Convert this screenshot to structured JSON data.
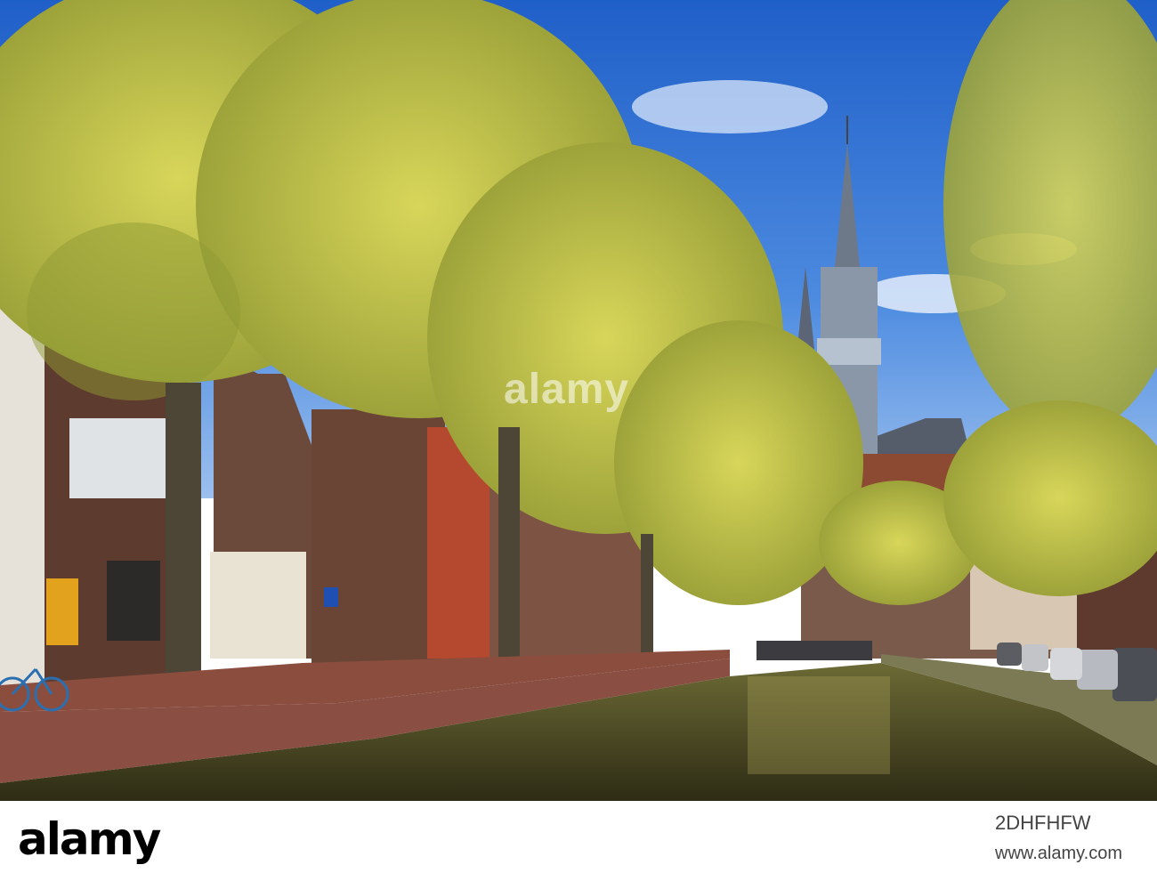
{
  "scene": {
    "description_colors": {
      "sky": "#2f6fd0",
      "foliage": "#c9c94a",
      "water": "#4b4a24",
      "brick": "#7a3b2e"
    }
  },
  "overlay_watermark": "alamy",
  "footer": {
    "logo": "alamy",
    "image_id": "2DHFHFW",
    "url": "www.alamy.com"
  }
}
